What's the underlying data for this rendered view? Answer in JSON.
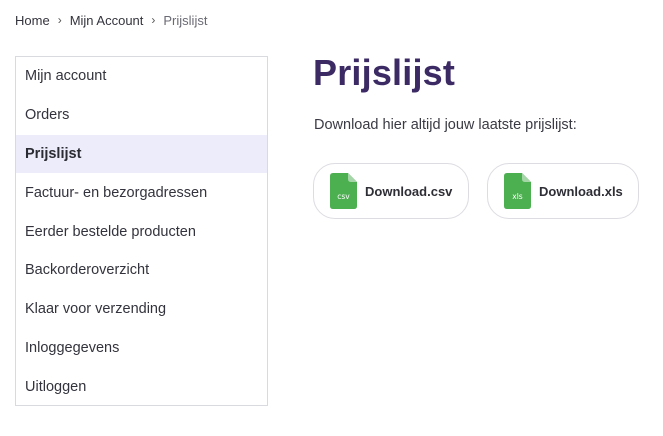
{
  "breadcrumb": {
    "items": [
      "Home",
      "Mijn Account",
      "Prijslijst"
    ]
  },
  "sidebar": {
    "items": [
      {
        "label": "Mijn account"
      },
      {
        "label": "Orders"
      },
      {
        "label": "Prijslijst",
        "active": true
      },
      {
        "label": "Factuur- en bezorgadressen"
      },
      {
        "label": "Eerder bestelde producten"
      },
      {
        "label": "Backorderoverzicht"
      },
      {
        "label": "Klaar voor verzending"
      },
      {
        "label": "Inloggegevens"
      },
      {
        "label": "Uitloggen"
      }
    ]
  },
  "main": {
    "title": "Prijslijst",
    "intro": "Download hier altijd jouw laatste prijslijst:",
    "downloads": [
      {
        "label": "Download.csv",
        "file_type": "csv",
        "icon": "csv-file-icon"
      },
      {
        "label": "Download.xls",
        "file_type": "xls",
        "icon": "xls-file-icon"
      }
    ]
  },
  "colors": {
    "title": "#3b2a63",
    "active_bg": "#ececfb",
    "file_icon": "#4caf50",
    "file_icon_fold": "#a5d6a7"
  }
}
